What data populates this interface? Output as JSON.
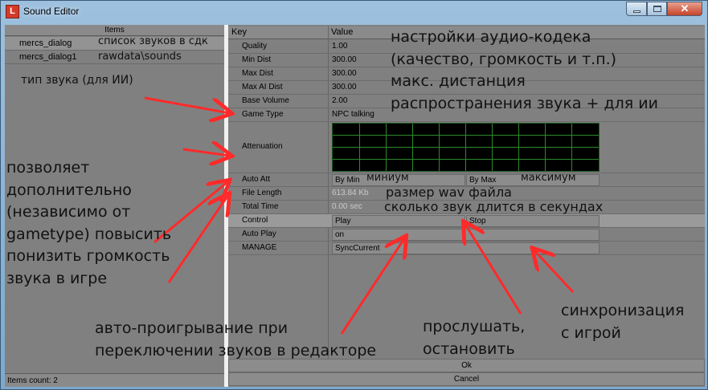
{
  "window": {
    "title": "Sound Editor",
    "icon": "app-icon"
  },
  "left": {
    "header": "Items",
    "items": [
      {
        "label": "mercs_dialog",
        "note": "список звуков в сдк"
      },
      {
        "label": "mercs_dialog1",
        "note": "rawdata\\sounds"
      }
    ],
    "count": "Items count: 2"
  },
  "props": {
    "header_key": "Key",
    "header_value": "Value",
    "rows": {
      "quality": {
        "key": "Quality",
        "value": "1.00"
      },
      "min_dist": {
        "key": "Min Dist",
        "value": "300.00"
      },
      "max_dist": {
        "key": "Max Dist",
        "value": "300.00"
      },
      "max_ai_dist": {
        "key": "Max AI Dist",
        "value": "300.00"
      },
      "base_volume": {
        "key": "Base Volume",
        "value": "2.00"
      },
      "game_type": {
        "key": "Game Type",
        "value": "NPC talking"
      },
      "attenuation": {
        "key": "Attenuation"
      },
      "auto_att": {
        "key": "Auto Att",
        "btn1": "By Min",
        "btn2": "By Max"
      },
      "file_length": {
        "key": "File Length",
        "value": "613.84 Kb"
      },
      "total_time": {
        "key": "Total Time",
        "value": "0.00 sec"
      },
      "control": {
        "key": "Control",
        "btn1": "Play",
        "btn2": "Stop"
      },
      "auto_play": {
        "key": "Auto Play",
        "value": "on"
      },
      "manage": {
        "key": "MANAGE",
        "value": "SyncCurrent"
      }
    },
    "ok": "Ok",
    "cancel": "Cancel"
  },
  "annotations": {
    "codec_1": "настройки аудио-кодека",
    "codec_2": "(качество, громкость и т.п.)",
    "dist_1": "макс. дистанция",
    "dist_2": "распространения звука + для ии",
    "sound_type": "тип звука (для ИИ)",
    "by_min": "миниум",
    "by_max": "максимум",
    "wav_size": "размер wav файла",
    "duration": "сколько звук длится в секундах",
    "boost_1": "позволяет",
    "boost_2": "дополнительно",
    "boost_3": "(независимо от",
    "boost_4": "gametype) повысить",
    "boost_5": "понизить громкость",
    "boost_6": "звука в игре",
    "autoplay_1": "авто-проигрывание  при",
    "autoplay_2": "переключении звуков в редакторе",
    "listen_1": "прослушать,",
    "listen_2": "остановить",
    "sync_1": "синхронизация",
    "sync_2": "с игрой"
  },
  "colors": {
    "arrow": "#ff2a2a",
    "graph_grid": "#2c8a2c"
  }
}
